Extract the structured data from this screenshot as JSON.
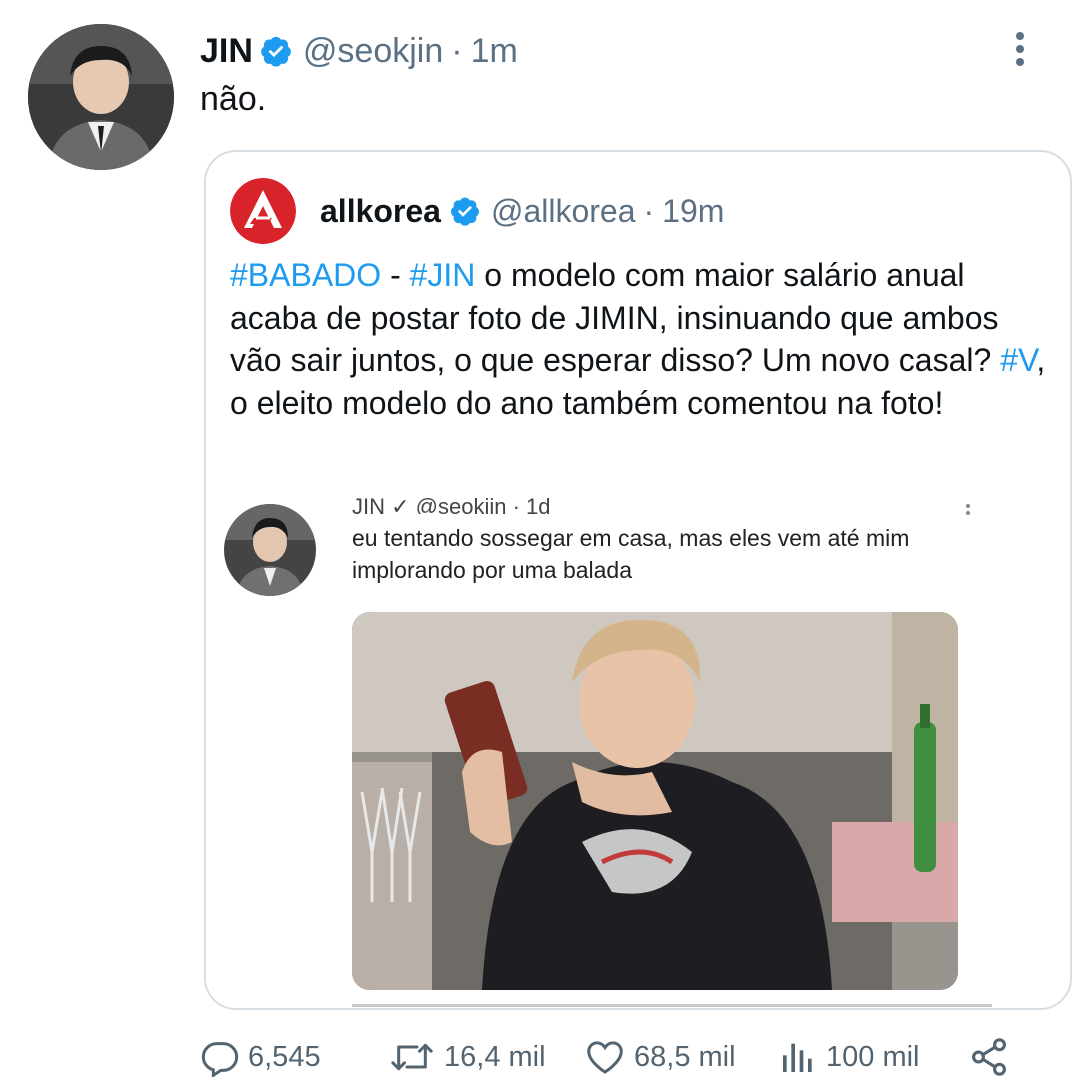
{
  "tweet": {
    "author_name": "JIN",
    "author_handle": "@seokjin",
    "time": "1m",
    "separator": "·",
    "text": "não."
  },
  "quote": {
    "author_name": "allkorea",
    "author_handle": "@allkorea",
    "time": "19m",
    "separator": "·",
    "body": {
      "hashtag1": "#BABADO",
      "dash": " - ",
      "hashtag2": "#JIN",
      "text1": " o modelo com maior salário anual acaba de postar foto de JIMIN, insinuando que ambos vão sair juntos, o que esperar disso? Um novo casal? ",
      "hashtag3": "#V",
      "text2": ", o eleito modelo do ano também comentou na foto!"
    },
    "embedded_screenshot": {
      "header": "JIN ✓ @seokjin · 1d",
      "text": "eu tentando sossegar em casa, mas eles vem até mim implorando por uma balada"
    }
  },
  "actions": {
    "replies": "6,545",
    "retweets": "16,4 mil",
    "likes": "68,5 mil",
    "views": "100 mil"
  },
  "icons": {
    "verified": "verified-badge-icon",
    "more": "more-vertical-icon",
    "reply": "reply-icon",
    "retweet": "retweet-icon",
    "like": "heart-icon",
    "views": "views-icon",
    "share": "share-icon"
  },
  "colors": {
    "accent": "#1d9bf0",
    "secondary_text": "#5b7083",
    "border": "#d6dde3",
    "allkorea_red": "#d8232a"
  }
}
